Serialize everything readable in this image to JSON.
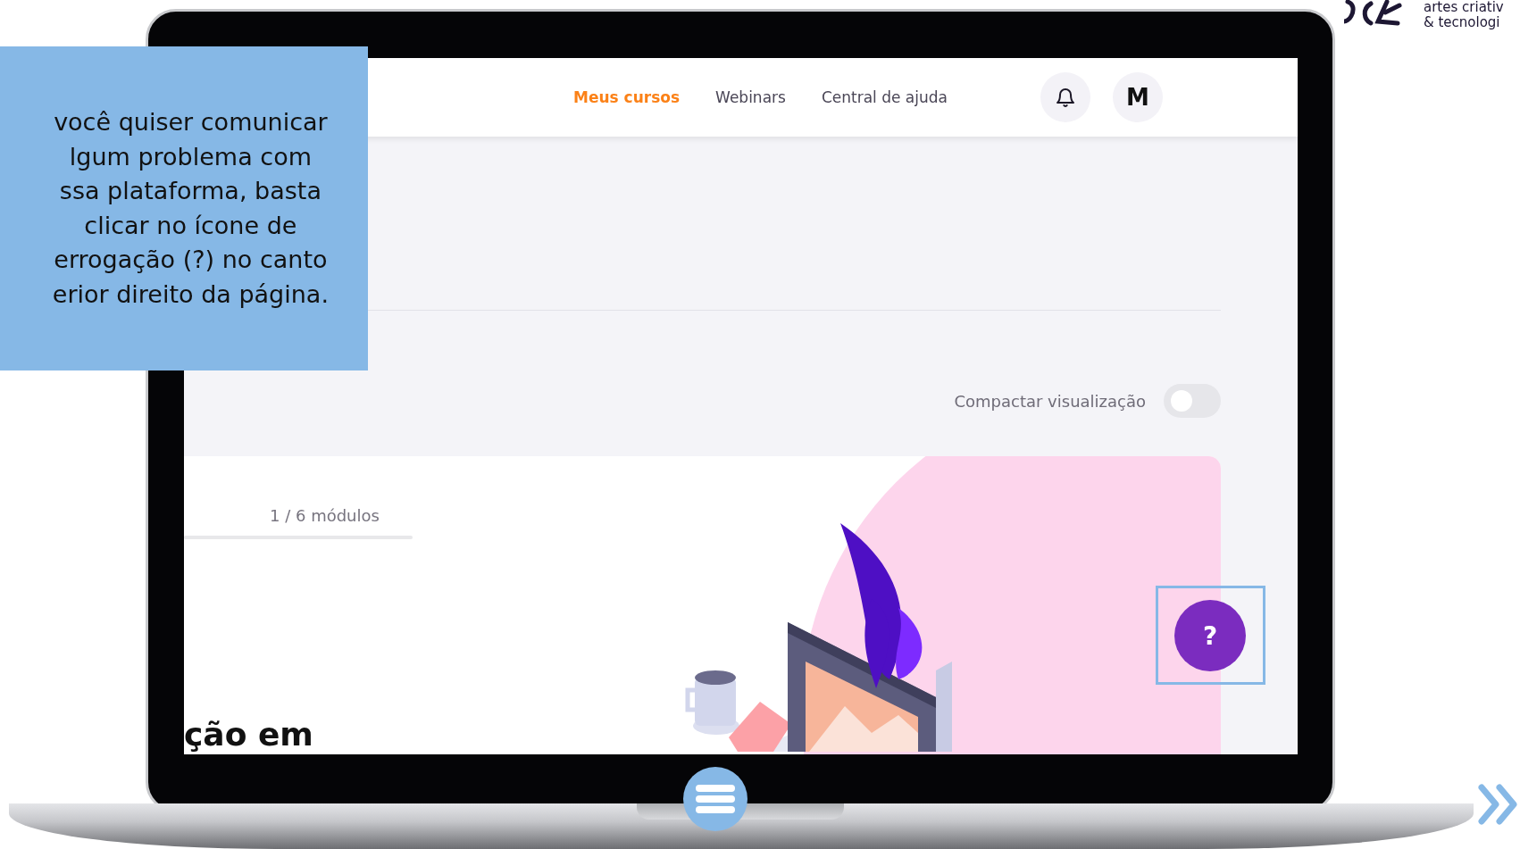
{
  "callout": {
    "lines": [
      "você quiser comunicar",
      "lgum problema com",
      "ssa plataforma, basta",
      "clicar no ícone de",
      "errogação (?) no canto",
      "erior direito da página."
    ]
  },
  "logo": {
    "lines": [
      "artes criativ",
      "& tecnologi"
    ]
  },
  "nav": {
    "items": [
      {
        "label": "Meus cursos",
        "selected": true
      },
      {
        "label": "Webinars",
        "selected": false
      },
      {
        "label": "Central de ajuda",
        "selected": false
      }
    ],
    "avatar": "M"
  },
  "toggle": {
    "label": "Compactar visualização",
    "on": false
  },
  "course": {
    "modules": "1 / 6 módulos",
    "title": "ção em"
  },
  "help_button": {
    "label": "?",
    "highlighted": true
  }
}
